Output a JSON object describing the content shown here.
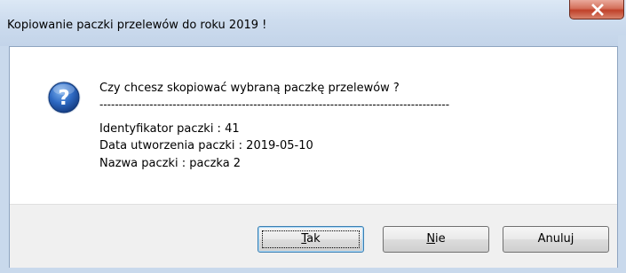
{
  "window": {
    "title": "Kopiowanie paczki przelewów do roku 2019 !"
  },
  "message": {
    "question": "Czy chcesz skopiować wybraną paczkę przelewów ?",
    "separator": "-------------------------------------------------------------------------------------------",
    "id_line": "Identyfikator paczki  : 41",
    "date_line": "Data utworzenia paczki : 2019-05-10",
    "name_line": "Nazwa paczki   : paczka 2"
  },
  "buttons": {
    "yes": {
      "mnemonic": "T",
      "rest": "ak"
    },
    "no": {
      "mnemonic": "N",
      "rest": "ie"
    },
    "cancel": {
      "label": "Anuluj"
    }
  },
  "colors": {
    "titlebar": "#cddcee",
    "close_button": "#c0412a",
    "icon_blue": "#1e56a8",
    "footer": "#f0f0f0"
  },
  "icons": {
    "dialog_icon": "question-icon",
    "close": "close-icon"
  }
}
